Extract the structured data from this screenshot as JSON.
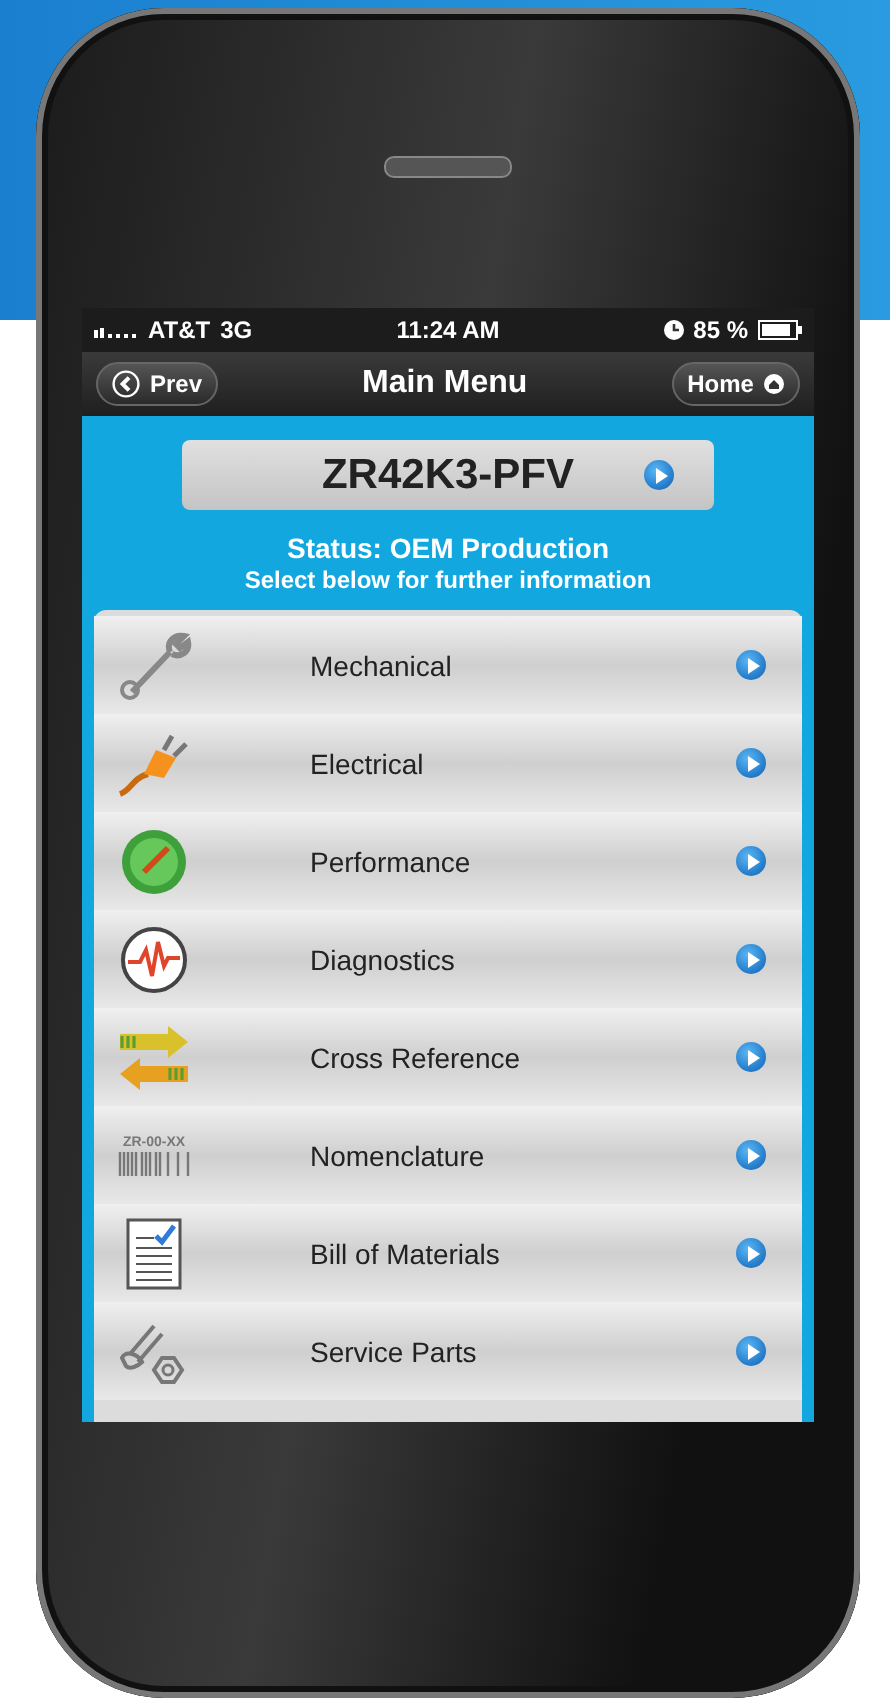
{
  "status_bar": {
    "carrier": "AT&T",
    "network": "3G",
    "time": "11:24 AM",
    "battery": "85 %"
  },
  "nav_bar": {
    "back": "Prev",
    "title": "Main Menu",
    "home": "Home"
  },
  "part_number": "ZR42K3-PFV",
  "status": "Status: OEM Production",
  "hint": "Select below for further information",
  "menu": [
    {
      "kind": "wrench",
      "label": "Mechanical"
    },
    {
      "kind": "plug",
      "label": "Electrical"
    },
    {
      "kind": "gauge",
      "label": "Performance"
    },
    {
      "kind": "pulse",
      "label": "Diagnostics"
    },
    {
      "kind": "arrows",
      "label": "Cross Reference"
    },
    {
      "kind": "barcode",
      "label": "Nomenclature",
      "icon_text": "ZR-00-XX"
    },
    {
      "kind": "document",
      "label": "Bill of Materials"
    },
    {
      "kind": "bolt",
      "label": "Service Parts"
    }
  ]
}
